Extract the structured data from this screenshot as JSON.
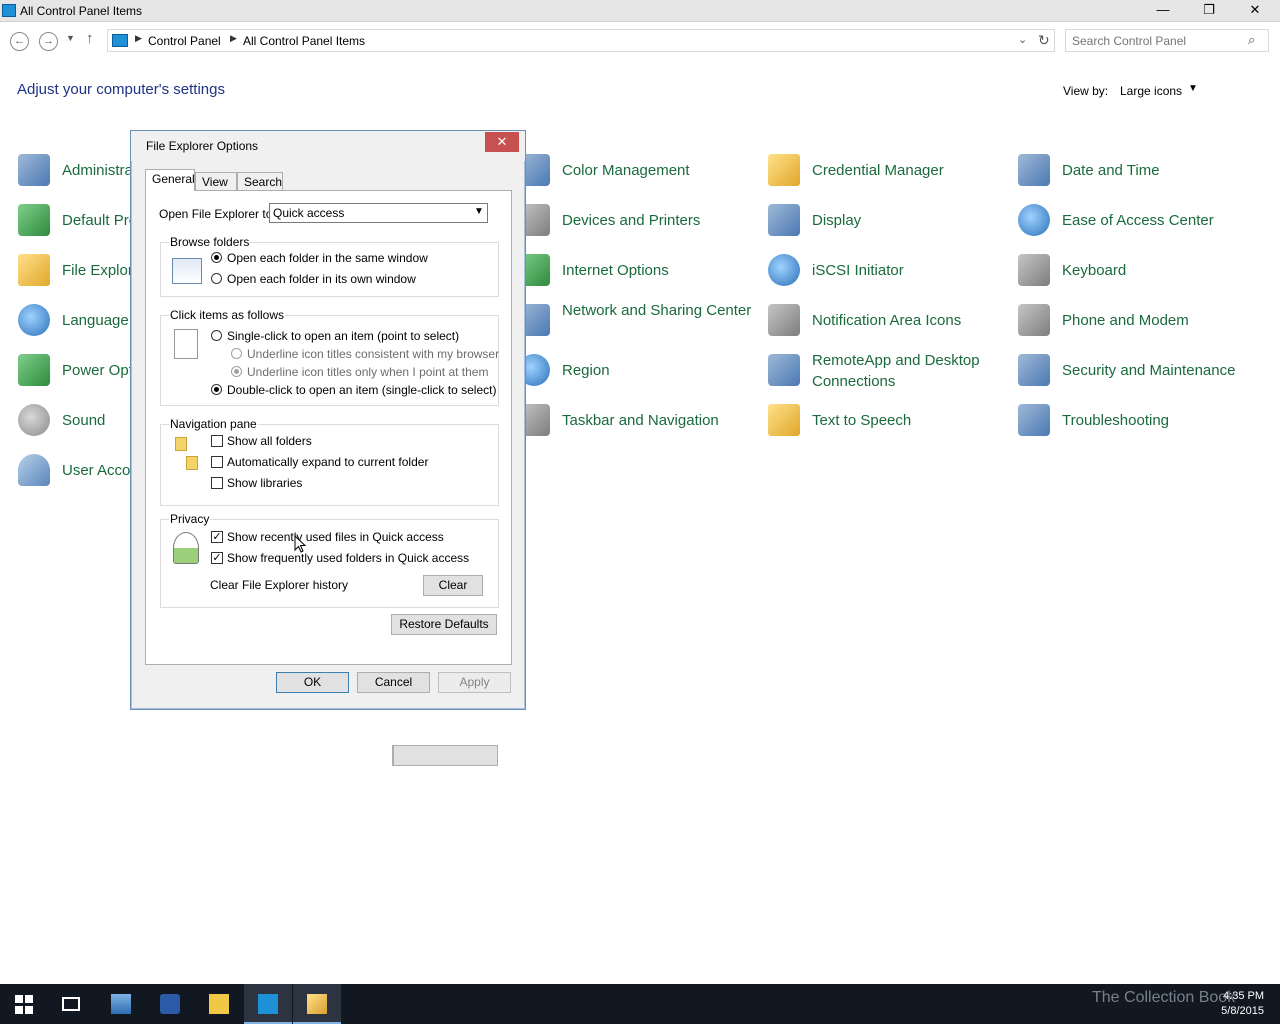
{
  "window": {
    "title": "All Control Panel Items",
    "minimize_glyph": "—",
    "restore_glyph": "❐",
    "close_glyph": "✕"
  },
  "address": {
    "crumbs": [
      "Control Panel",
      "All Control Panel Items"
    ],
    "search_placeholder": "Search Control Panel"
  },
  "main": {
    "heading": "Adjust your computer's settings",
    "view_by_label": "View by:",
    "view_by_value": "Large icons"
  },
  "items": [
    {
      "label": "Administrative Tools",
      "icon": "administrative-tools-icon"
    },
    {
      "label": "Default Programs",
      "icon": "default-programs-icon"
    },
    {
      "label": "File Explorer Options",
      "icon": "file-explorer-options-icon"
    },
    {
      "label": "Language",
      "icon": "language-icon"
    },
    {
      "label": "Power Options",
      "icon": "power-options-icon"
    },
    {
      "label": "Sound",
      "icon": "sound-icon"
    },
    {
      "label": "User Accounts",
      "icon": "user-accounts-icon"
    },
    {
      "label": "Color Management",
      "icon": "color-management-icon"
    },
    {
      "label": "Devices and Printers",
      "icon": "devices-printers-icon"
    },
    {
      "label": "Internet Options",
      "icon": "internet-options-icon"
    },
    {
      "label": "Network and Sharing Center",
      "icon": "network-sharing-icon"
    },
    {
      "label": "Region",
      "icon": "region-icon"
    },
    {
      "label": "Taskbar and Navigation",
      "icon": "taskbar-navigation-icon"
    },
    {
      "label": "Credential Manager",
      "icon": "credential-manager-icon"
    },
    {
      "label": "Display",
      "icon": "display-icon"
    },
    {
      "label": "iSCSI Initiator",
      "icon": "iscsi-initiator-icon"
    },
    {
      "label": "Notification Area Icons",
      "icon": "notification-area-icon"
    },
    {
      "label": "RemoteApp and Desktop Connections",
      "icon": "remoteapp-icon"
    },
    {
      "label": "Text to Speech",
      "icon": "text-to-speech-icon"
    },
    {
      "label": "Date and Time",
      "icon": "date-time-icon"
    },
    {
      "label": "Ease of Access Center",
      "icon": "ease-of-access-icon"
    },
    {
      "label": "Keyboard",
      "icon": "keyboard-icon"
    },
    {
      "label": "Phone and Modem",
      "icon": "phone-modem-icon"
    },
    {
      "label": "Security and Maintenance",
      "icon": "security-maintenance-icon"
    },
    {
      "label": "Troubleshooting",
      "icon": "troubleshooting-icon"
    }
  ],
  "dialog": {
    "title": "File Explorer Options",
    "tabs": [
      "General",
      "View",
      "Search"
    ],
    "open_to_label": "Open File Explorer to:",
    "open_to_value": "Quick access",
    "browse": {
      "title": "Browse folders",
      "options": [
        "Open each folder in the same window",
        "Open each folder in its own window"
      ],
      "selected": 0
    },
    "click": {
      "title": "Click items as follows",
      "single": "Single-click to open an item (point to select)",
      "underline_browser": "Underline icon titles consistent with my browser",
      "underline_point": "Underline icon titles only when I point at them",
      "double": "Double-click to open an item (single-click to select)"
    },
    "nav": {
      "title": "Navigation pane",
      "show_all": "Show all folders",
      "expand": "Automatically expand to current folder",
      "libraries": "Show libraries"
    },
    "privacy": {
      "title": "Privacy",
      "recent_files": "Show recently used files in Quick access",
      "frequent_folders": "Show frequently used folders in Quick access",
      "clear_label": "Clear File Explorer history",
      "clear_button": "Clear"
    },
    "restore_button": "Restore Defaults",
    "ok": "OK",
    "cancel": "Cancel",
    "apply": "Apply"
  },
  "taskbar": {
    "time": "4:35 PM",
    "date": "5/8/2015",
    "watermark": "The Collection Book"
  }
}
